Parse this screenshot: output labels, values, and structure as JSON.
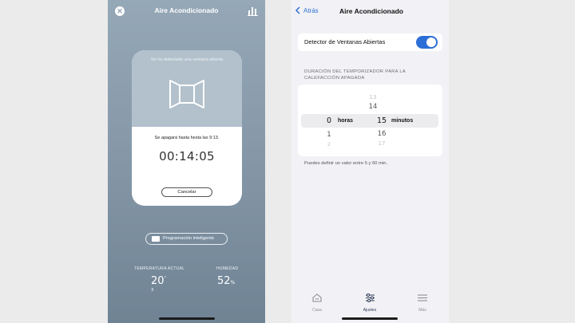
{
  "left": {
    "title": "Aire Acondicionado",
    "card": {
      "detected_text": "Se ha detectado una ventana abierta",
      "until_text": "Se apagará hasta hesta las 9:13.",
      "timer": "00:14:05",
      "cancel_label": "Cancelar"
    },
    "smart_schedule_label": "Programación inteligente",
    "temp_label": "TEMPERATURA ACTUAL",
    "temp_value": "20",
    "temp_decimal": "3",
    "temp_unit": "°",
    "humidity_label": "HUMEDAD",
    "humidity_value": "52",
    "humidity_unit": "%",
    "colors": {
      "bg_top": "#95a8b7",
      "bg_bottom": "#6f8394"
    }
  },
  "right": {
    "back_label": "Atrás",
    "title": "Aire Acondicionado",
    "toggle_label": "Detector de Ventanas Abiertas",
    "toggle_on": true,
    "section_title": "DURACIÓN DEL TEMPORIZADOR PARA LA CALEFACCIÓN APAGADA",
    "picker": {
      "hours_label": "horas",
      "minutes_label": "minutos",
      "hours_selected": "0",
      "minutes_selected": "15",
      "hours_below": [
        "1",
        "2"
      ],
      "minutes_above": [
        "13",
        "14"
      ],
      "minutes_below": [
        "16",
        "17"
      ]
    },
    "hint": "Puedes definir un valor entre 5 y 60 min.",
    "tabs": [
      {
        "label": "Casa",
        "icon": "house-icon"
      },
      {
        "label": "Ajustes",
        "icon": "sliders-icon"
      },
      {
        "label": "Más",
        "icon": "menu-icon"
      }
    ],
    "colors": {
      "accent": "#2b6fd6"
    }
  }
}
